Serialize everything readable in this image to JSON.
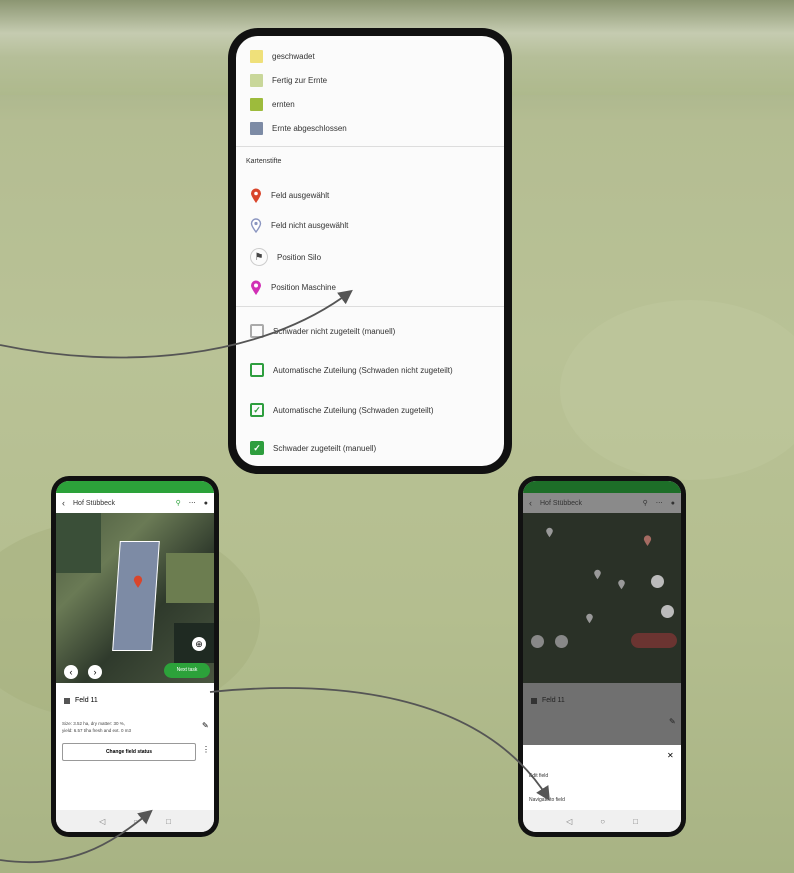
{
  "legend": {
    "status_items": [
      {
        "label": "geschwadet",
        "color": "#efe07a"
      },
      {
        "label": "Fertig zur Ernte",
        "color": "#c9d79a"
      },
      {
        "label": "ernten",
        "color": "#9dbb3c"
      },
      {
        "label": "Ernte abgeschlossen",
        "color": "#7d8ba5"
      }
    ],
    "section_title": "Kartenstifte",
    "pins": [
      {
        "label": "Feld ausgewählt",
        "icon": "pin-red-icon",
        "color": "#d9452b"
      },
      {
        "label": "Feld nicht ausgewählt",
        "icon": "pin-outline-icon",
        "color": "#8a95c0"
      },
      {
        "label": "Position Silo",
        "icon": "flag-icon",
        "color": "#444444"
      },
      {
        "label": "Position Maschine",
        "icon": "pin-magenta-icon",
        "color": "#d12fb5"
      }
    ],
    "checkbox_items": [
      {
        "label": "Schwader nicht zugeteilt (manuell)",
        "state": "empty-grey"
      },
      {
        "label": "Automatische Zuteilung (Schwaden nicht zugeteilt)",
        "state": "empty-green"
      },
      {
        "label": "Automatische Zuteilung (Schwaden zugeteilt)",
        "state": "outlined-checked"
      },
      {
        "label": "Schwader zugeteilt (manuell)",
        "state": "filled-checked"
      }
    ]
  },
  "left_phone": {
    "title": "Hof Stübbeck",
    "field_name": "Feld 11",
    "field_info_line1": "Size: 3.52 ha, dry matter: 30 %,",
    "field_info_line2": "yield: 6.57 t/ha fresh and ext. 0 m3",
    "button_label": "Change field status",
    "next_button": "Next task",
    "accent": "#2ca23a"
  },
  "right_phone": {
    "title": "Hof Stübbeck",
    "field_name": "Feld 11",
    "sheet_item1": "Edit field",
    "sheet_item2": "Navigate to field",
    "accent": "#2ca23a"
  }
}
